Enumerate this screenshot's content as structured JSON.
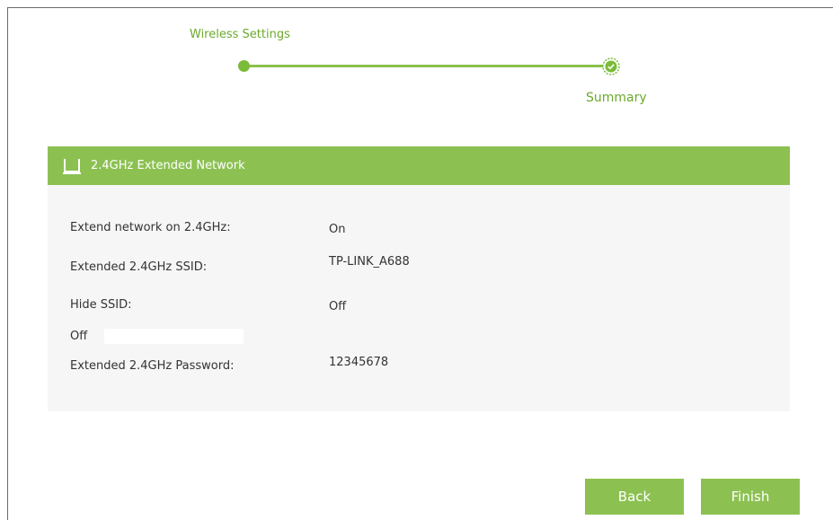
{
  "stepper": {
    "step1_label": "Wireless Settings",
    "step2_label": "Summary"
  },
  "panel": {
    "title": "2.4GHz Extended Network",
    "icon": "router-icon",
    "rows": [
      {
        "label": "Extend network on 2.4GHz:",
        "value": "On"
      },
      {
        "label": "Extended 2.4GHz SSID:",
        "value": "TP-LINK_A688"
      },
      {
        "label": "Hide SSID:",
        "value": "Off"
      },
      {
        "label": "Off",
        "value": ""
      },
      {
        "label": "Extended 2.4GHz Password:",
        "value": "12345678"
      }
    ]
  },
  "buttons": {
    "back": "Back",
    "finish": "Finish"
  },
  "colors": {
    "accent": "#8cc152",
    "accent_text": "#6aaa2a",
    "panel_bg": "#f6f6f6"
  }
}
